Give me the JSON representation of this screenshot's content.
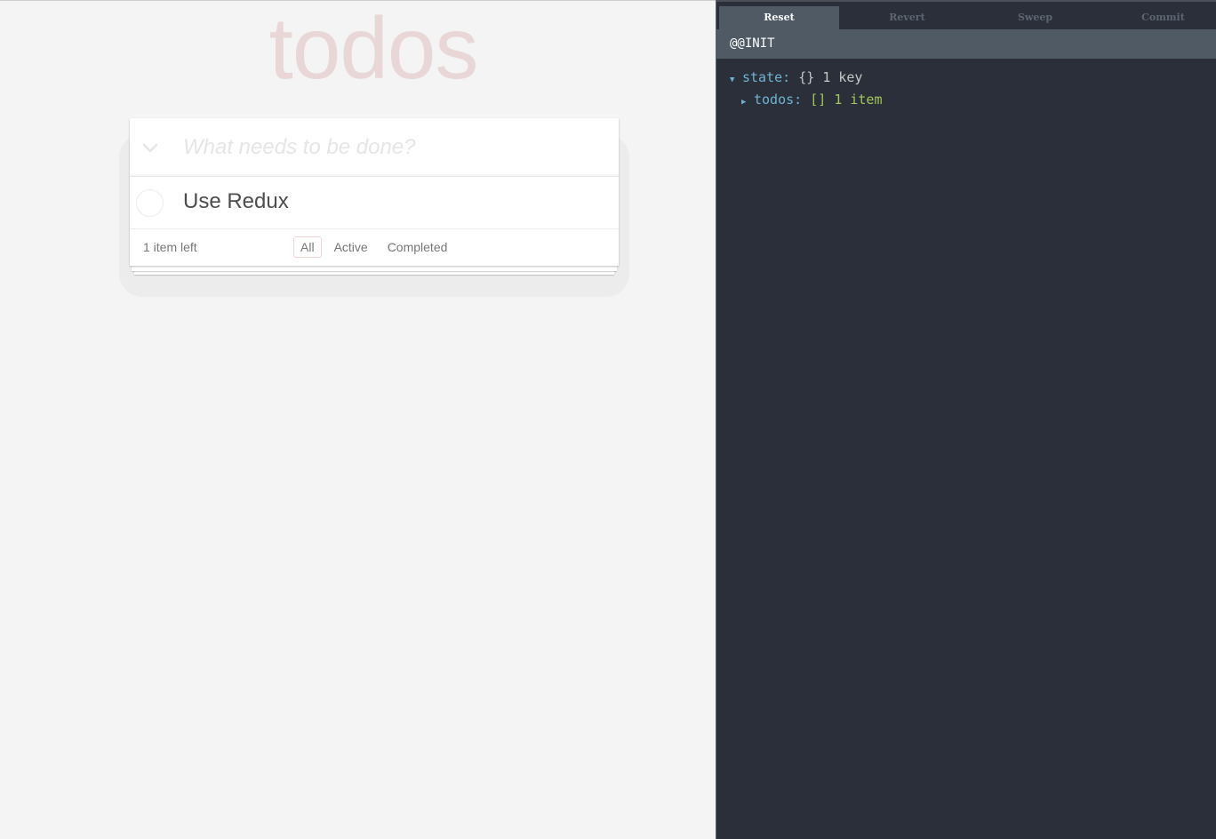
{
  "app": {
    "title": "todos",
    "new_todo_placeholder": "What needs to be done?",
    "todos": [
      {
        "text": "Use Redux",
        "completed": false
      }
    ],
    "footer": {
      "count_text": "1 item left",
      "filters": [
        "All",
        "Active",
        "Completed"
      ],
      "selected_filter": "All"
    },
    "colors": {
      "title": "#e9d3d3",
      "background": "#f4f4f4",
      "text": "#4d4d4d"
    }
  },
  "devtools": {
    "tabs": [
      "Reset",
      "Revert",
      "Sweep",
      "Commit"
    ],
    "active_tab": "Reset",
    "action": "@@INIT",
    "tree": {
      "root_key": "state:",
      "root_brace": "{}",
      "root_meta": "1 key",
      "child_key": "todos:",
      "child_bracket": "[]",
      "child_meta": "1 item"
    },
    "colors": {
      "background": "#2a2f3a",
      "key": "#6fb3d2",
      "meta_green": "#a1c659"
    }
  }
}
